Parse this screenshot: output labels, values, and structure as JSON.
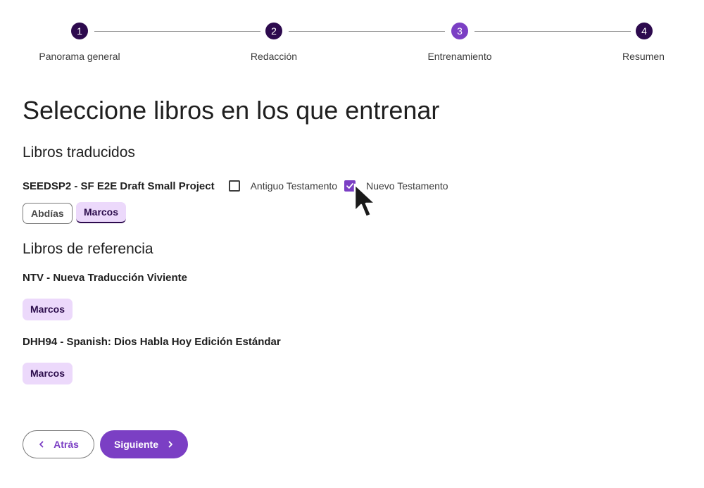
{
  "stepper": {
    "steps": [
      {
        "number": "1",
        "label": "Panorama general"
      },
      {
        "number": "2",
        "label": "Redacción"
      },
      {
        "number": "3",
        "label": "Entrenamiento"
      },
      {
        "number": "4",
        "label": "Resumen"
      }
    ],
    "active_step": 3
  },
  "page_title": "Seleccione libros en los que entrenar",
  "translated": {
    "heading": "Libros traducidos",
    "project_name": "SEEDSP2 - SF E2E Draft Small Project",
    "old_testament_label": "Antiguo Testamento",
    "old_testament_checked": false,
    "new_testament_label": "Nuevo Testamento",
    "new_testament_checked": true,
    "books": [
      {
        "label": "Abdías",
        "selected": false
      },
      {
        "label": "Marcos",
        "selected": true
      }
    ]
  },
  "reference": {
    "heading": "Libros de referencia",
    "sources": [
      {
        "name": "NTV - Nueva Traducción Viviente",
        "books": [
          "Marcos"
        ]
      },
      {
        "name": "DHH94 - Spanish: Dios Habla Hoy Edición Estándar",
        "books": [
          "Marcos"
        ]
      }
    ]
  },
  "footer": {
    "back_label": "Atrás",
    "next_label": "Siguiente"
  },
  "colors": {
    "primary": "#7b3fc4",
    "dark_step": "#2d0a4e",
    "chip_bg": "#ecd9fb"
  },
  "icons": {
    "back": "chevron-left-icon",
    "next": "chevron-right-icon",
    "check": "check-icon",
    "cursor": "mouse-pointer-icon"
  }
}
